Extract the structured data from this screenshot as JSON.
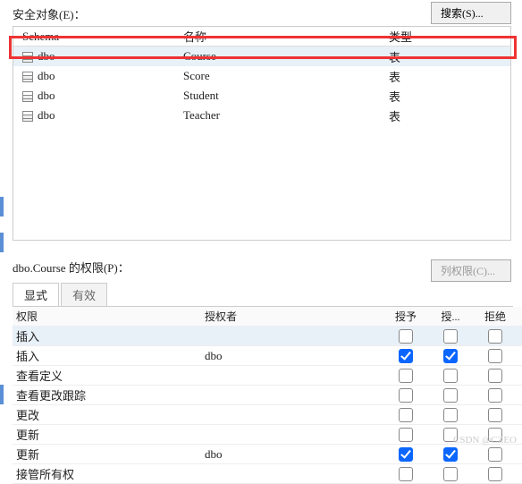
{
  "top": {
    "securables_label": "安全对象(E)：",
    "search_btn": "搜索(S)..."
  },
  "grid1": {
    "headers": {
      "schema": "Schema",
      "name": "名称",
      "type": "类型"
    },
    "rows": [
      {
        "schema": "dbo",
        "name": "Course",
        "type": "表",
        "highlight": true
      },
      {
        "schema": "dbo",
        "name": "Score",
        "type": "表"
      },
      {
        "schema": "dbo",
        "name": "Student",
        "type": "表"
      },
      {
        "schema": "dbo",
        "name": "Teacher",
        "type": "表"
      }
    ]
  },
  "perm": {
    "label": "dbo.Course 的权限(P)：",
    "col_perm_btn": "列权限(C)..."
  },
  "tabs": {
    "explicit": "显式",
    "effective": "有效"
  },
  "grid2": {
    "headers": {
      "perm": "权限",
      "grantor": "授权者",
      "grant": "授予",
      "withgrant": "授...",
      "deny": "拒绝"
    },
    "rows": [
      {
        "perm": "插入",
        "grantor": "",
        "grant": false,
        "with": false,
        "deny": false
      },
      {
        "perm": "插入",
        "grantor": "dbo",
        "grant": true,
        "with": true,
        "deny": false
      },
      {
        "perm": "查看定义",
        "grantor": "",
        "grant": false,
        "with": false,
        "deny": false
      },
      {
        "perm": "查看更改跟踪",
        "grantor": "",
        "grant": false,
        "with": false,
        "deny": false
      },
      {
        "perm": "更改",
        "grantor": "",
        "grant": false,
        "with": false,
        "deny": false
      },
      {
        "perm": "更新",
        "grantor": "",
        "grant": false,
        "with": false,
        "deny": false
      },
      {
        "perm": "更新",
        "grantor": "dbo",
        "grant": true,
        "with": true,
        "deny": false
      },
      {
        "perm": "接管所有权",
        "grantor": "",
        "grant": false,
        "with": false,
        "deny": false
      }
    ]
  },
  "watermark": "CSDN @CZEO"
}
